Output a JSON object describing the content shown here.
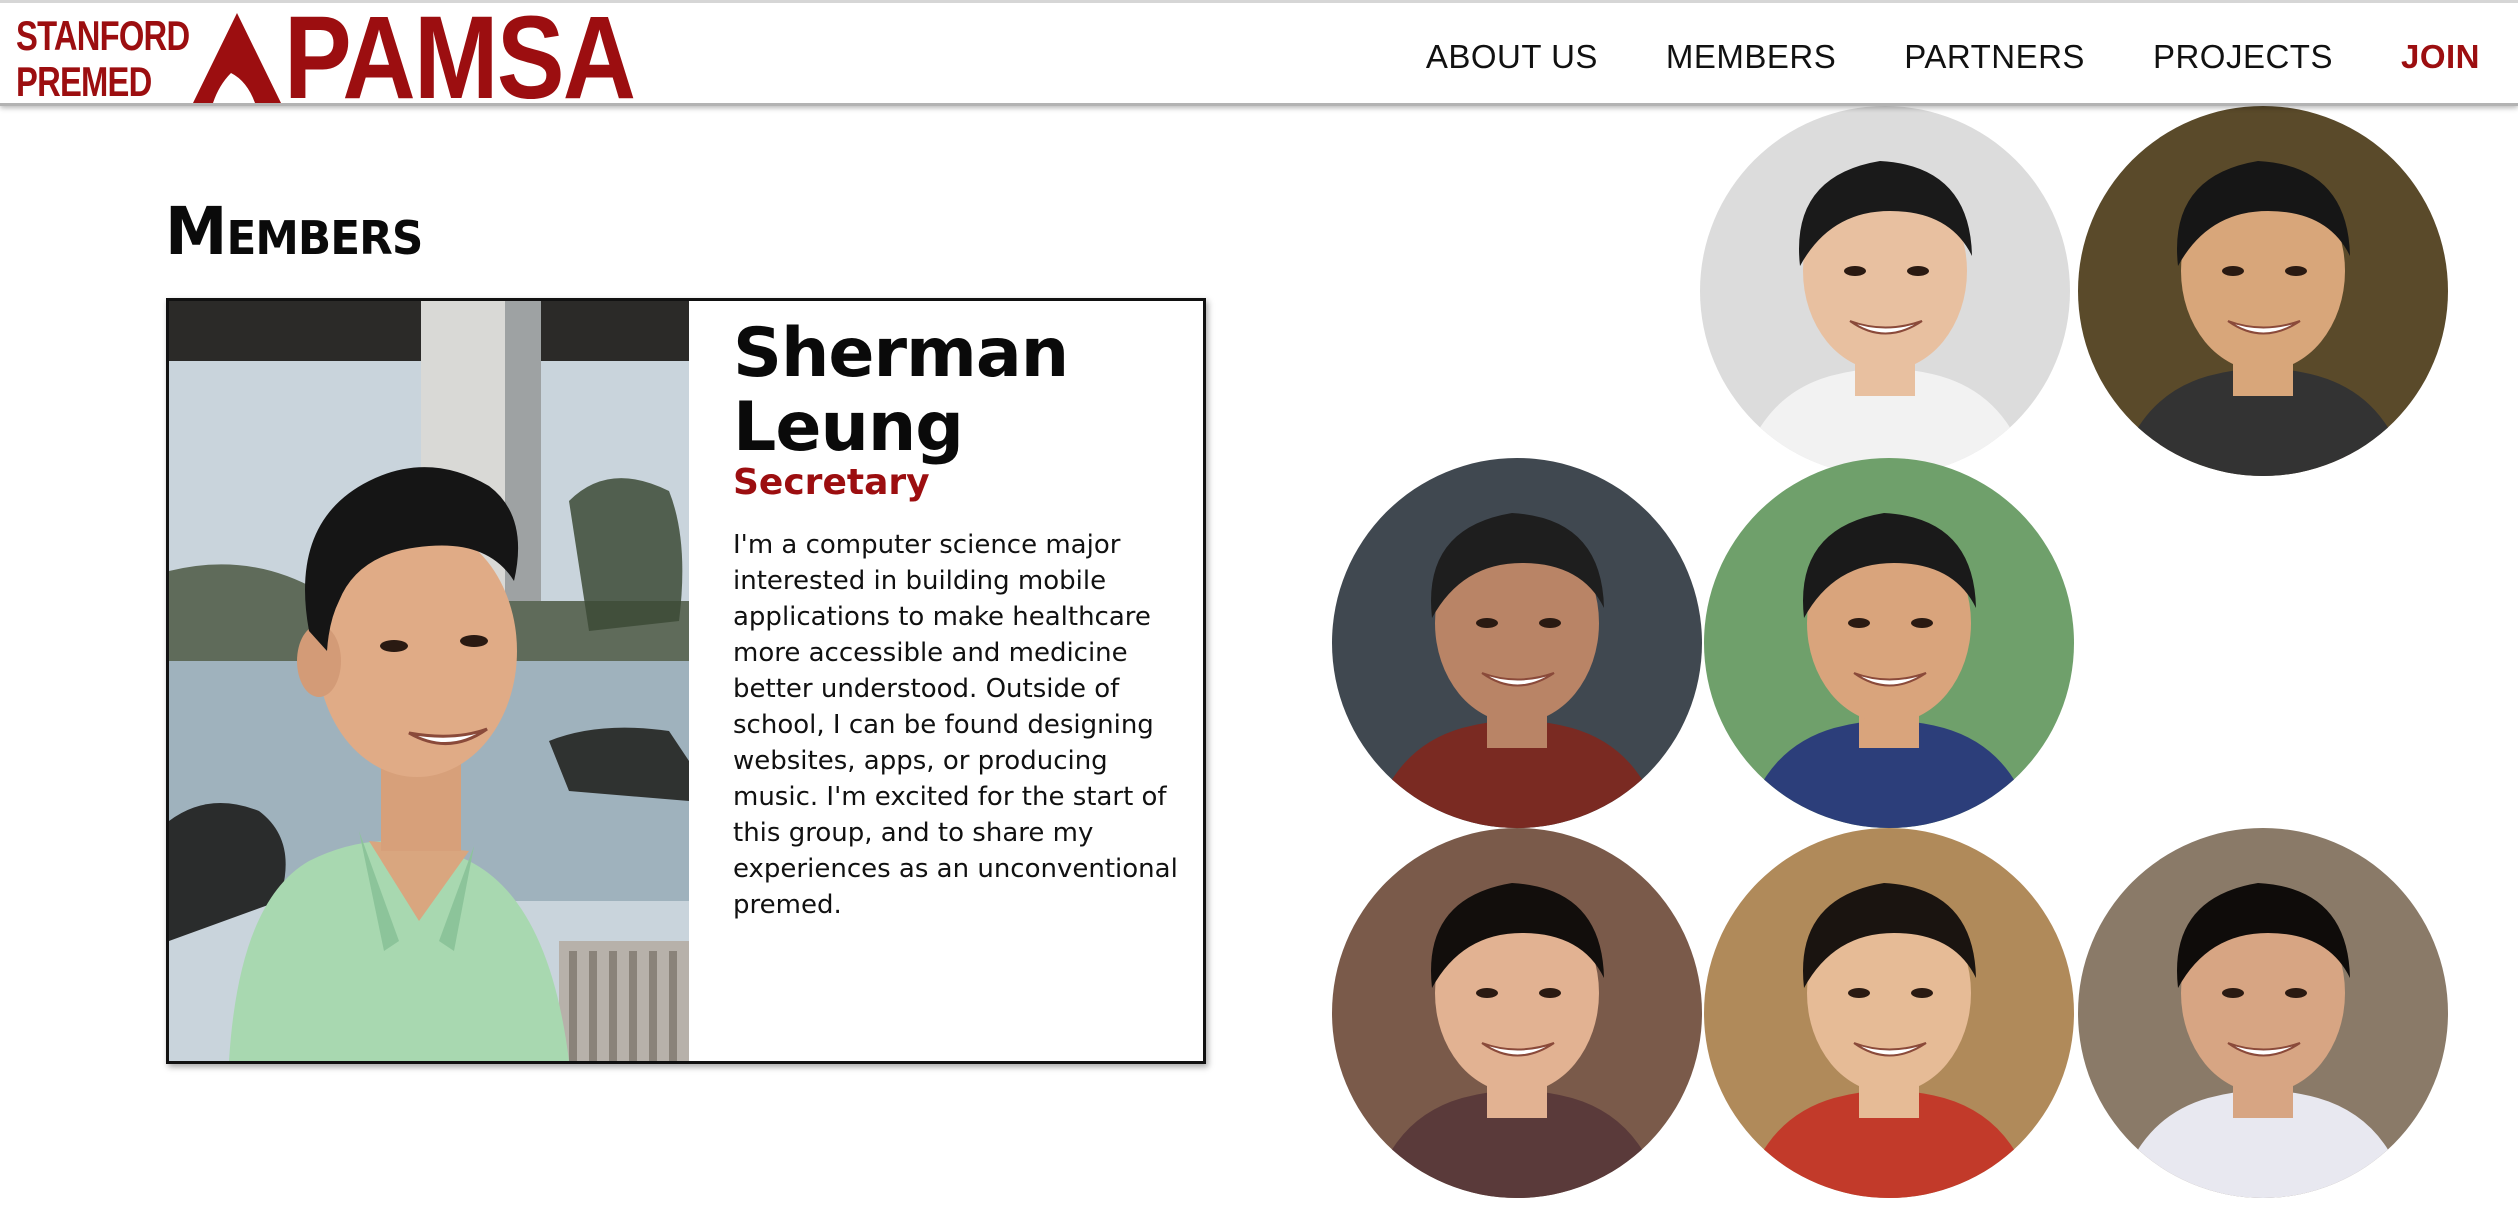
{
  "header": {
    "logo_top": "STANFORD",
    "logo_bottom": "PREMED",
    "logo_wordmark": "PAMSA",
    "nav": [
      "ABOUT US",
      "MEMBERS",
      "PARTNERS",
      "PROJECTS",
      "JOIN"
    ]
  },
  "main": {
    "title": "Members"
  },
  "member_card": {
    "name": "Sherman Leung",
    "role": "Secretary",
    "bio": "I'm a computer science major interested in building mobile applications to make healthcare more accessible and medicine better understood. Outside of school, I can be found designing websites, apps, or producing music. I'm excited for the start of this group, and to share my experiences as an unconventional premed."
  },
  "colors": {
    "brand": "#9c0e10",
    "text": "#111111",
    "background": "#ffffff"
  },
  "avatars": [
    {
      "name": "member-avatar-1",
      "bg": "#dcdcdc",
      "skin": "#e8c0a0",
      "hair": "#1a1a1a",
      "shirt": "#f2f2f2"
    },
    {
      "name": "member-avatar-2",
      "bg": "#5a4a2a",
      "skin": "#d8a67a",
      "hair": "#161616",
      "shirt": "#333333"
    },
    {
      "name": "member-avatar-3",
      "bg": "#404850",
      "skin": "#b98466",
      "hair": "#1e1e1e",
      "shirt": "#7a2a22"
    },
    {
      "name": "member-avatar-4",
      "bg": "#6fa06b",
      "skin": "#d9a47c",
      "hair": "#1a1a1a",
      "shirt": "#2c3e7a"
    },
    {
      "name": "member-avatar-5",
      "bg": "#7a5a4a",
      "skin": "#e2b292",
      "hair": "#120e0c",
      "shirt": "#5a3a3a"
    },
    {
      "name": "member-avatar-6",
      "bg": "#b08a5a",
      "skin": "#e6bb96",
      "hair": "#1a1410",
      "shirt": "#c23a2a"
    },
    {
      "name": "member-avatar-7",
      "bg": "#8a7a68",
      "skin": "#d7a583",
      "hair": "#0f0c0a",
      "shirt": "#e8e8f0"
    }
  ]
}
